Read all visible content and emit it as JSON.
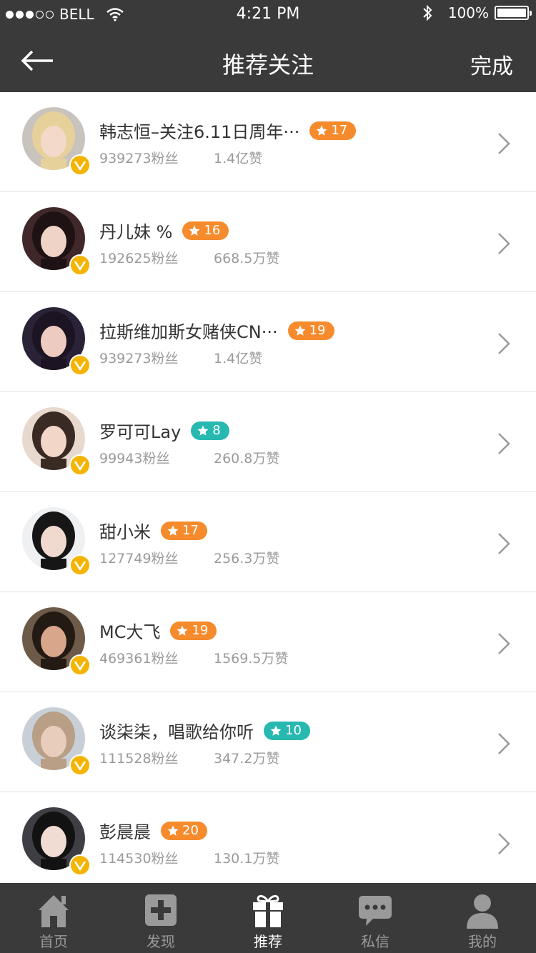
{
  "status_bar": {
    "carrier": "BELL",
    "time": "4:21 PM",
    "battery": "100%",
    "battery_level": 1.0
  },
  "nav": {
    "title": "推荐关注",
    "done": "完成"
  },
  "users": [
    {
      "name": "韩志恒–关注6.11日周年···",
      "level": "17",
      "level_color": "#f58b2c",
      "fans": "939273粉丝",
      "likes": "1.4亿赞"
    },
    {
      "name": "丹儿妹 %",
      "level": "16",
      "level_color": "#f58b2c",
      "fans": "192625粉丝",
      "likes": "668.5万赞"
    },
    {
      "name": "拉斯维加斯女赌侠CN···",
      "level": "19",
      "level_color": "#f58b2c",
      "fans": "939273粉丝",
      "likes": "1.4亿赞"
    },
    {
      "name": "罗可可Lay",
      "level": "8",
      "level_color": "#27b8b0",
      "fans": "99943粉丝",
      "likes": "260.8万赞"
    },
    {
      "name": "甜小米",
      "level": "17",
      "level_color": "#f58b2c",
      "fans": "127749粉丝",
      "likes": "256.3万赞"
    },
    {
      "name": "MC大飞",
      "level": "19",
      "level_color": "#f58b2c",
      "fans": "469361粉丝",
      "likes": "1569.5万赞"
    },
    {
      "name": "谈柒柒，唱歌给你听",
      "level": "10",
      "level_color": "#27b8b0",
      "fans": "111528粉丝",
      "likes": "347.2万赞"
    },
    {
      "name": "彭晨晨",
      "level": "20",
      "level_color": "#f58b2c",
      "fans": "114530粉丝",
      "likes": "130.1万赞"
    }
  ],
  "tabs": [
    {
      "label": "首页",
      "icon": "home-icon"
    },
    {
      "label": "发现",
      "icon": "discover-plus-icon"
    },
    {
      "label": "推荐",
      "icon": "gift-icon",
      "active": true
    },
    {
      "label": "私信",
      "icon": "chat-bubble-icon"
    },
    {
      "label": "我的",
      "icon": "profile-icon"
    }
  ],
  "colors": {
    "bar_bg": "#3a3a3a",
    "orange_badge": "#f58b2c",
    "teal_badge": "#27b8b0",
    "verified_badge": "#f5b400"
  }
}
